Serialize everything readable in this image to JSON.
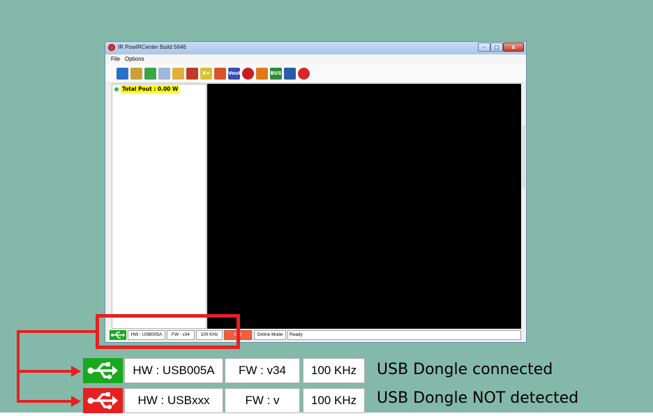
{
  "window": {
    "title": "IR PowIRCenter Build 5646",
    "buttons": {
      "minimize": "–",
      "maximize": "□",
      "close": "x"
    }
  },
  "menu": {
    "file": "File",
    "options": "Options"
  },
  "toolbar": {
    "icons": [
      {
        "name": "layout-icon",
        "color": "#2a6fc9",
        "label": ""
      },
      {
        "name": "grid-icon",
        "color": "#c9a13a",
        "label": ""
      },
      {
        "name": "scatter-icon",
        "color": "#3aa64a",
        "label": ""
      },
      {
        "name": "new-file-icon",
        "color": "#9fb7d8",
        "label": ""
      },
      {
        "name": "open-folder-icon",
        "color": "#e0b03a",
        "label": ""
      },
      {
        "name": "save-icon",
        "color": "#c0392b",
        "label": ""
      },
      {
        "name": "xy-formula-icon",
        "color": "#d8c030",
        "label": "X="
      },
      {
        "name": "waveform-icon",
        "color": "#d9542a",
        "label": ""
      },
      {
        "name": "vout-icon",
        "color": "#3a4fb0",
        "label": "Vout"
      },
      {
        "name": "scope-icon",
        "color": "#c81e1e",
        "label": ""
      },
      {
        "name": "fire-icon",
        "color": "#e07a1a",
        "label": ""
      },
      {
        "name": "i2c-bus-icon",
        "color": "#2f8a3a",
        "label": "BUS"
      },
      {
        "name": "circuit-icon",
        "color": "#2a5da8",
        "label": ""
      },
      {
        "name": "ir-logo-icon",
        "color": "#d62828",
        "label": ""
      }
    ]
  },
  "left_pane": {
    "total_pout": "Total Pout : 0.00 W"
  },
  "statusbar": {
    "hw": "HW : USB005A",
    "fw": "FW : v34",
    "freq": "100 KHz",
    "error": "0 D",
    "mode": "Online Mode",
    "state": "Ready"
  },
  "legend": {
    "connected": {
      "hw": "HW : USB005A",
      "fw": "FW : v34",
      "freq": "100 KHz",
      "caption": "USB Dongle connected",
      "color": "#1aa81e"
    },
    "not_detected": {
      "hw": "HW : USBxxx",
      "fw": "FW : v",
      "freq": "100 KHz",
      "caption": "USB Dongle NOT detected",
      "color": "#e62020"
    }
  },
  "colors": {
    "background": "#84b9a9",
    "highlight": "#e62020",
    "graph_bg": "#000000"
  }
}
